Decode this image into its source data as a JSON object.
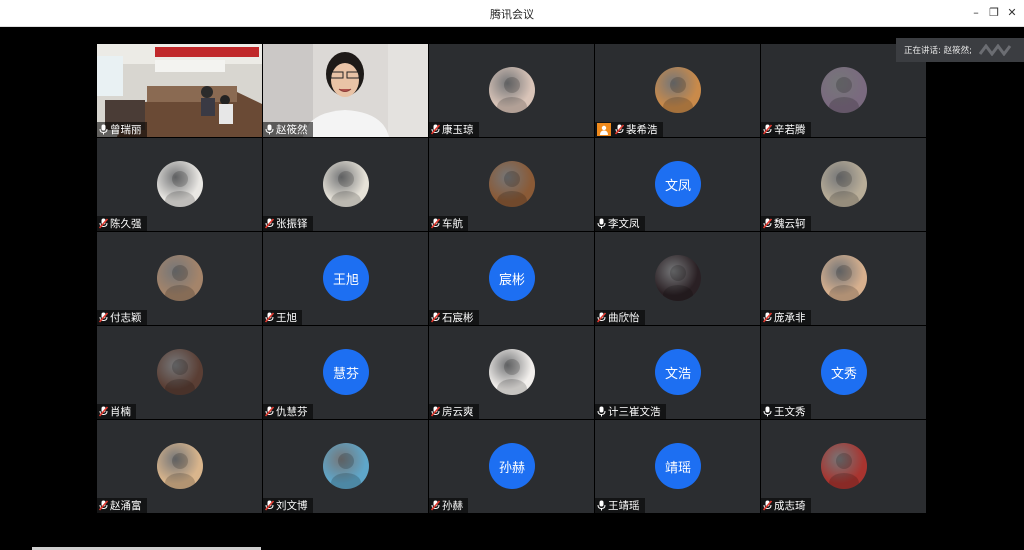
{
  "window": {
    "title": "腾讯会议",
    "minimize": "–",
    "restore": "❐",
    "close": "✕"
  },
  "speaking": {
    "label": "正在讲话: 赵筱然;"
  },
  "tiles": [
    {
      "name": "曾瑞丽",
      "kind": "video-room",
      "mic": "on"
    },
    {
      "name": "赵筱然",
      "kind": "video-face",
      "mic": "on"
    },
    {
      "name": "康玉琼",
      "kind": "photo",
      "color": "#d9c4b8",
      "mic": "muted"
    },
    {
      "name": "裴希浩",
      "kind": "photo",
      "color": "#c98a4a",
      "mic": "muted",
      "host": true
    },
    {
      "name": "辛若腾",
      "kind": "photo",
      "color": "#7a6a7f",
      "mic": "muted"
    },
    {
      "name": "陈久强",
      "kind": "photo",
      "color": "#e9e7e3",
      "mic": "muted"
    },
    {
      "name": "张振铎",
      "kind": "photo",
      "color": "#e6e2d8",
      "mic": "muted"
    },
    {
      "name": "车航",
      "kind": "photo",
      "color": "#8a5a36",
      "mic": "muted"
    },
    {
      "name": "李文凤",
      "kind": "text",
      "avatar_text": "文凤",
      "mic": "on"
    },
    {
      "name": "魏云轲",
      "kind": "photo",
      "color": "#b8ad98",
      "mic": "muted"
    },
    {
      "name": "付志颖",
      "kind": "photo",
      "color": "#a4846a",
      "mic": "muted"
    },
    {
      "name": "王旭",
      "kind": "text",
      "avatar_text": "王旭",
      "mic": "muted"
    },
    {
      "name": "石宸彬",
      "kind": "text",
      "avatar_text": "宸彬",
      "mic": "muted"
    },
    {
      "name": "曲欣怡",
      "kind": "photo",
      "color": "#2a2024",
      "mic": "muted"
    },
    {
      "name": "庞承非",
      "kind": "photo",
      "color": "#d7b08e",
      "mic": "muted"
    },
    {
      "name": "肖楠",
      "kind": "photo",
      "color": "#5a3e34",
      "mic": "muted"
    },
    {
      "name": "仇慧芬",
      "kind": "text",
      "avatar_text": "慧芬",
      "mic": "muted"
    },
    {
      "name": "房云爽",
      "kind": "photo",
      "color": "#f2efec",
      "mic": "muted"
    },
    {
      "name": "计三崔文浩",
      "kind": "text",
      "avatar_text": "文浩",
      "mic": "on"
    },
    {
      "name": "王文秀",
      "kind": "text",
      "avatar_text": "文秀",
      "mic": "on"
    },
    {
      "name": "赵涌富",
      "kind": "photo",
      "color": "#d9b58c",
      "mic": "muted"
    },
    {
      "name": "刘文博",
      "kind": "photo",
      "color": "#5fa6c9",
      "mic": "muted"
    },
    {
      "name": "孙赫",
      "kind": "text",
      "avatar_text": "孙赫",
      "mic": "muted"
    },
    {
      "name": "王靖瑶",
      "kind": "text",
      "avatar_text": "靖瑶",
      "mic": "on"
    },
    {
      "name": "成志琦",
      "kind": "photo",
      "color": "#a8342f",
      "mic": "muted"
    }
  ]
}
